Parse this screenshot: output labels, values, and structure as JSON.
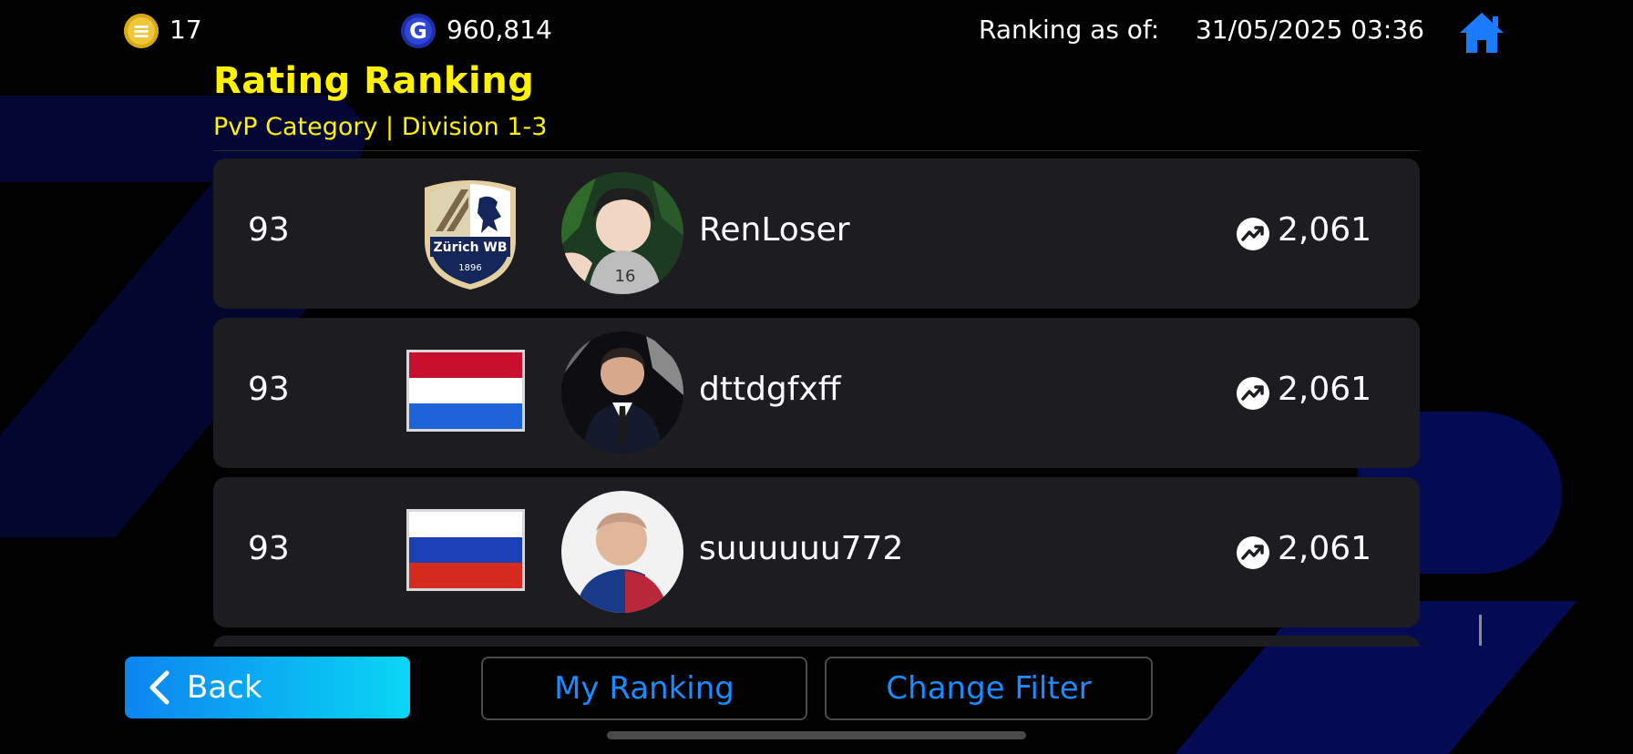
{
  "topbar": {
    "coin_e_symbol": "≡",
    "coin_e_value": "17",
    "coin_g_symbol": "G",
    "coin_g_value": "960,814",
    "ranking_label": "Ranking as of:",
    "ranking_datetime": "31/05/2025 03:36"
  },
  "header": {
    "title": "Rating Ranking",
    "subtitle": "PvP Category | Division 1-3"
  },
  "rows": [
    {
      "rank": "93",
      "club_badge_text": "Zürich WB",
      "club_badge_year": "1896",
      "name": "RenLoser",
      "rating": "2,061"
    },
    {
      "rank": "93",
      "flag": "netherlands",
      "name": "dttdgfxff",
      "rating": "2,061"
    },
    {
      "rank": "93",
      "flag": "russia",
      "name": "suuuuuu772",
      "rating": "2,061"
    }
  ],
  "buttons": {
    "back": "Back",
    "my_ranking": "My Ranking",
    "change_filter": "Change Filter"
  },
  "colors": {
    "accent_yellow": "#fff200",
    "accent_blue": "#1a8cff",
    "row_bg": "#1d1d21"
  }
}
